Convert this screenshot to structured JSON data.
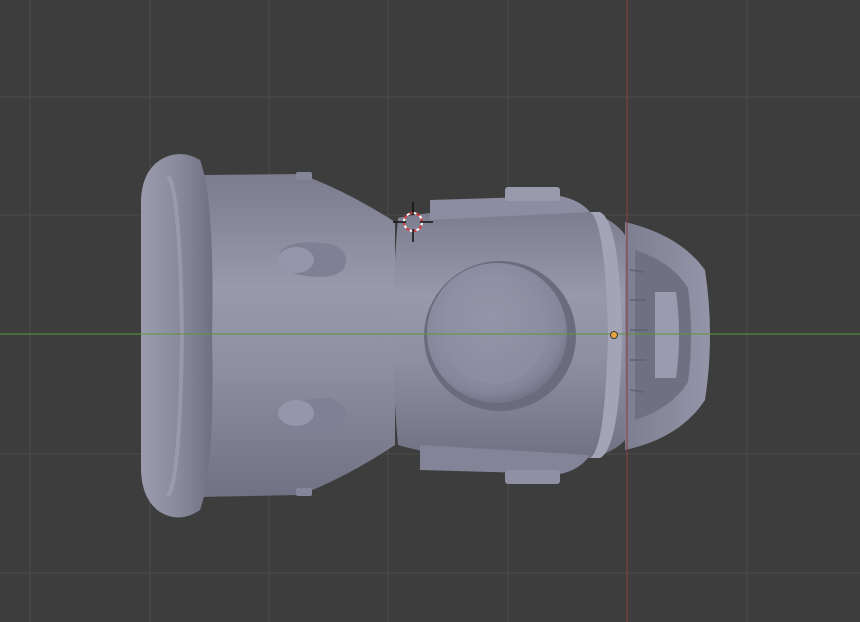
{
  "viewport": {
    "view": "top-orthographic",
    "background_color": "#3d3d3d",
    "grid_color": "#4a4a4a",
    "axis_x_color": "#5c9a3a",
    "axis_y_color": "#8e3a3a",
    "grid_visible": true
  },
  "scene": {
    "mesh_color": "#8f90a3",
    "mesh_object": "sculpted-mesh",
    "cursor_icon": "3d-cursor-icon",
    "origin_color": "#e8a33a"
  }
}
